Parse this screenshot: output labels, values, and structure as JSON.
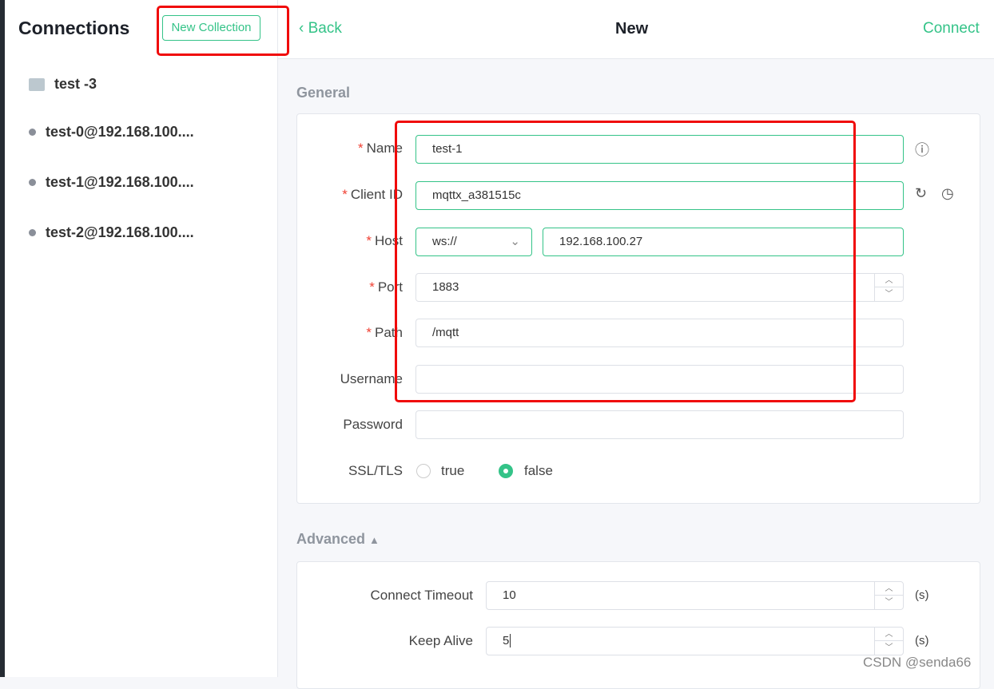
{
  "sidebar": {
    "title": "Connections",
    "new_collection": "New Collection",
    "items": [
      {
        "label": "test -3",
        "type": "folder"
      },
      {
        "label": "test-0@192.168.100...."
      },
      {
        "label": "test-1@192.168.100...."
      },
      {
        "label": "test-2@192.168.100...."
      }
    ]
  },
  "header": {
    "back": "Back",
    "title": "New",
    "connect": "Connect"
  },
  "general": {
    "title": "General",
    "name": {
      "label": "Name",
      "value": "test-1"
    },
    "client_id": {
      "label": "Client ID",
      "value": "mqttx_a381515c"
    },
    "host": {
      "label": "Host",
      "protocol": "ws://",
      "value": "192.168.100.27"
    },
    "port": {
      "label": "Port",
      "value": "1883"
    },
    "path": {
      "label": "Path",
      "value": "/mqtt"
    },
    "username": {
      "label": "Username",
      "value": ""
    },
    "password": {
      "label": "Password",
      "value": ""
    },
    "ssl": {
      "label": "SSL/TLS",
      "true": "true",
      "false": "false",
      "selected": "false"
    }
  },
  "advanced": {
    "title": "Advanced",
    "connect_timeout": {
      "label": "Connect Timeout",
      "value": "10",
      "unit": "(s)"
    },
    "keep_alive": {
      "label": "Keep Alive",
      "value": "5",
      "unit": "(s)"
    }
  },
  "watermark": "CSDN @senda66",
  "colors": {
    "accent": "#34c388",
    "annotation": "#f00a0a"
  }
}
